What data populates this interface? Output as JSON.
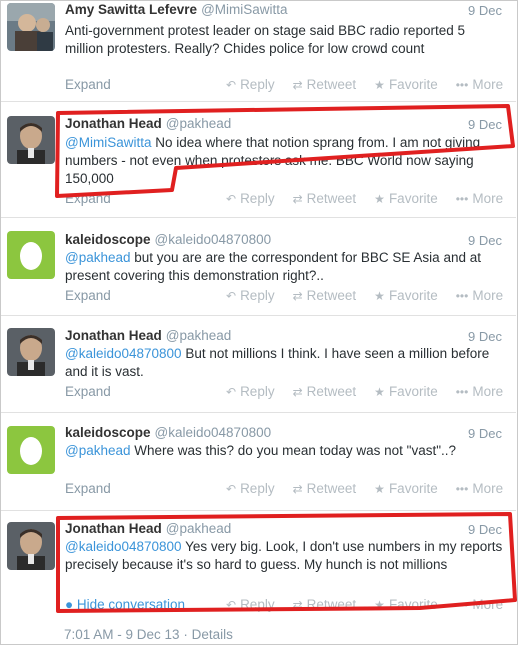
{
  "tweets": [
    {
      "author": "Amy Sawitta Lefevre",
      "handle": "@MimiSawitta",
      "date": "9 Dec",
      "mention": "",
      "text": "Anti-government protest leader on stage said BBC radio reported 5 million protesters. Really? Chides police for low crowd count",
      "expand": "Expand"
    },
    {
      "author": "Jonathan Head",
      "handle": "@pakhead",
      "date": "9 Dec",
      "mention": "@MimiSawitta",
      "text": " No idea where that notion sprang from. I am not giving numbers - not even when protesters ask me. BBC World now saying 150,000",
      "expand": "Expand"
    },
    {
      "author": "kaleidoscope",
      "handle": "@kaleido04870800",
      "date": "9 Dec",
      "mention": "@pakhead",
      "text": " but you are are the correspondent for  BBC SE Asia and at present covering this demonstration right?..",
      "expand": "Expand"
    },
    {
      "author": "Jonathan Head",
      "handle": "@pakhead",
      "date": "9 Dec",
      "mention": "@kaleido04870800",
      "text": " But not millions I think. I have seen a million before and it is vast.",
      "expand": "Expand"
    },
    {
      "author": "kaleidoscope",
      "handle": "@kaleido04870800",
      "date": "9 Dec",
      "mention": "@pakhead",
      "text": " Where was this?   do you mean today was not \"vast\"..?",
      "expand": "Expand"
    },
    {
      "author": "Jonathan Head",
      "handle": "@pakhead",
      "date": "9 Dec",
      "mention": "@kaleido04870800",
      "text": " Yes very big. Look, I don't use numbers in my reports precisely because it's so hard to guess. My hunch is not millions",
      "hide": "Hide conversation"
    }
  ],
  "actions": {
    "reply": "Reply",
    "retweet": "Retweet",
    "favorite": "Favorite",
    "more": "More"
  },
  "footer": {
    "timestamp": "7:01 AM - 9 Dec 13",
    "separator": "·",
    "details": "Details"
  },
  "colors": {
    "link": "#3b94d9",
    "muted": "#8899a6",
    "annotation": "#e02020",
    "egg_background": "#8cc63f"
  },
  "icons": {
    "reply": "reply-icon",
    "retweet": "retweet-icon",
    "favorite": "star-icon",
    "more": "more-dots-icon",
    "hide": "bullet-icon"
  }
}
